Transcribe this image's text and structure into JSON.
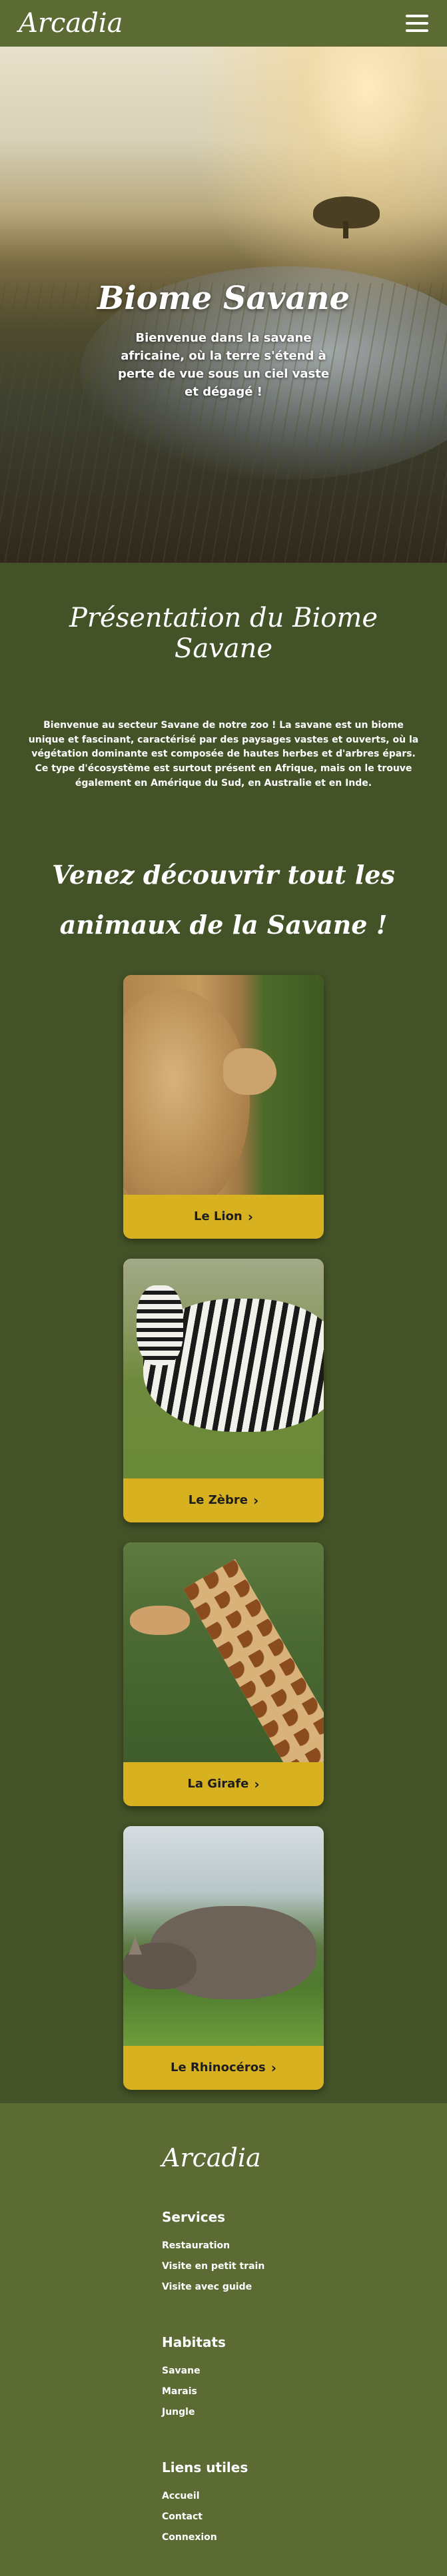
{
  "header": {
    "brand": "Arcadia",
    "menu_icon": "hamburger-menu-icon"
  },
  "hero": {
    "title": "Biome Savane",
    "subtitle": "Bienvenue dans la savane africaine, où la terre s'étend à perte de vue sous un ciel vaste et dégagé !"
  },
  "presentation": {
    "title": "Présentation du Biome Savane",
    "text": "Bienvenue au secteur Savane de notre zoo ! La savane est un biome unique et fascinant, caractérisé par des paysages vastes et ouverts, où la végétation dominante est composée de hautes herbes et d'arbres épars. Ce type d'écosystème est surtout présent en Afrique, mais on le trouve également en Amérique du Sud, en Australie et en Inde."
  },
  "discover": {
    "title": "Venez découvrir tout les animaux de la Savane !"
  },
  "animals": [
    {
      "label": "Le Lion",
      "chevron": "chevron-right-icon"
    },
    {
      "label": "Le Zèbre",
      "chevron": "chevron-right-icon"
    },
    {
      "label": "La Girafe",
      "chevron": "chevron-right-icon"
    },
    {
      "label": "Le Rhinocéros",
      "chevron": "chevron-right-icon"
    }
  ],
  "footer": {
    "brand": "Arcadia",
    "services": {
      "title": "Services",
      "links": [
        "Restauration",
        "Visite en petit train",
        "Visite avec guide"
      ]
    },
    "habitats": {
      "title": "Habitats",
      "links": [
        "Savane",
        "Marais",
        "Jungle"
      ]
    },
    "useful": {
      "title": "Liens utiles",
      "links": [
        "Accueil",
        "Contact",
        "Connexion"
      ]
    }
  },
  "colors": {
    "background": "#435227",
    "header": "#5b6b33",
    "button": "#d8b121"
  }
}
